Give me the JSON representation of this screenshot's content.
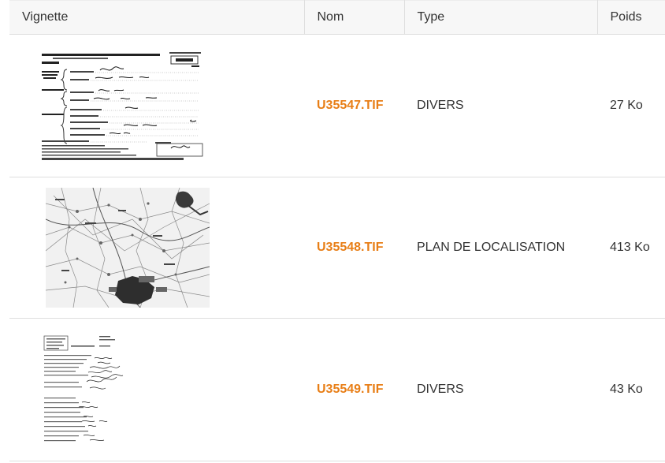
{
  "columns": {
    "vignette": "Vignette",
    "nom": "Nom",
    "type": "Type",
    "poids": "Poids"
  },
  "rows": [
    {
      "nom": "U35547.TIF",
      "type": "DIVERS",
      "poids": "27 Ko",
      "thumb_kind": "form-document"
    },
    {
      "nom": "U35548.TIF",
      "type": "PLAN DE LOCALISATION",
      "poids": "413 Ko",
      "thumb_kind": "location-map"
    },
    {
      "nom": "U35549.TIF",
      "type": "DIVERS",
      "poids": "43 Ko",
      "thumb_kind": "handwritten-document"
    }
  ],
  "colors": {
    "link": "#e87e16",
    "header_bg": "#f7f7f7",
    "border": "#dedede"
  }
}
